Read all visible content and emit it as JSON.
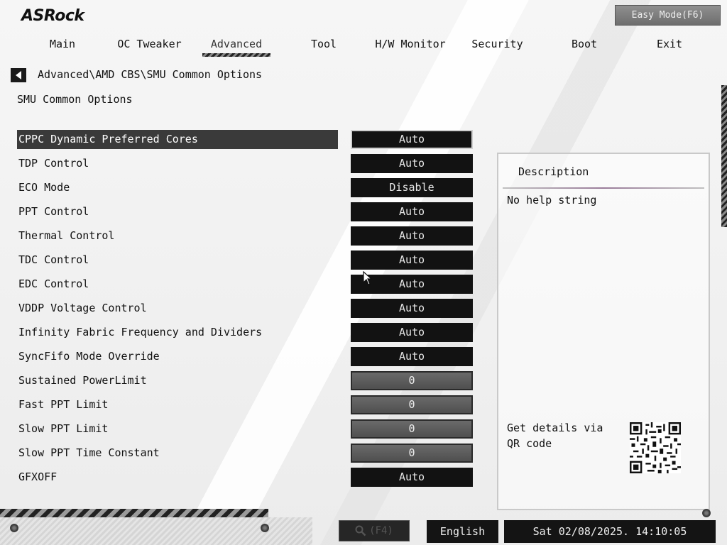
{
  "brand": {
    "logo_text": "ASRock"
  },
  "header": {
    "easy_mode_label": "Easy Mode(F6)"
  },
  "tabs": [
    {
      "label": "Main"
    },
    {
      "label": "OC Tweaker"
    },
    {
      "label": "Advanced",
      "active": true
    },
    {
      "label": "Tool"
    },
    {
      "label": "H/W Monitor"
    },
    {
      "label": "Security"
    },
    {
      "label": "Boot"
    },
    {
      "label": "Exit"
    }
  ],
  "breadcrumb": "Advanced\\AMD CBS\\SMU Common Options",
  "section_title": "SMU Common Options",
  "settings": [
    {
      "label": "CPPC Dynamic Preferred Cores",
      "value": "Auto",
      "selected": true
    },
    {
      "label": "TDP Control",
      "value": "Auto"
    },
    {
      "label": "ECO Mode",
      "value": "Disable"
    },
    {
      "label": "PPT Control",
      "value": "Auto"
    },
    {
      "label": "Thermal Control",
      "value": "Auto"
    },
    {
      "label": "TDC Control",
      "value": "Auto"
    },
    {
      "label": "EDC Control",
      "value": "Auto"
    },
    {
      "label": "VDDP Voltage Control",
      "value": "Auto"
    },
    {
      "label": "Infinity Fabric Frequency and Dividers",
      "value": "Auto"
    },
    {
      "label": "SyncFifo Mode Override",
      "value": "Auto"
    },
    {
      "label": "Sustained PowerLimit",
      "value": "0",
      "numeric": true
    },
    {
      "label": "Fast PPT Limit",
      "value": "0",
      "numeric": true
    },
    {
      "label": "Slow PPT Limit",
      "value": "0",
      "numeric": true
    },
    {
      "label": "Slow PPT Time Constant",
      "value": "0",
      "numeric": true
    },
    {
      "label": "GFXOFF",
      "value": "Auto"
    }
  ],
  "description": {
    "title": "Description",
    "text": "No help string",
    "qr_text": "Get details via QR code"
  },
  "footer": {
    "search_label": "(F4)",
    "language": "English",
    "datetime": "Sat 02/08/2025. 14:10:05"
  },
  "colors": {
    "selected_row_bg": "#3a3a3a",
    "option_bg": "#121212",
    "numeric_option_bg": "#5c5c5c"
  }
}
